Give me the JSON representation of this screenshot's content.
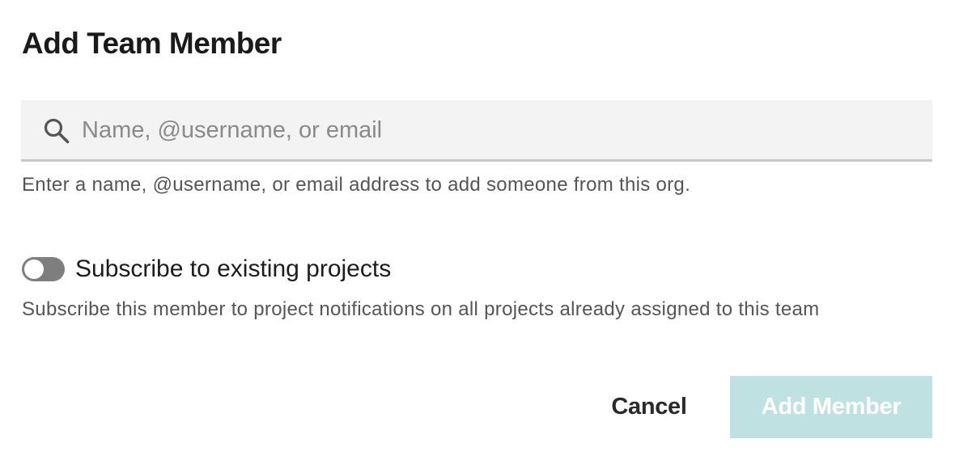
{
  "dialog": {
    "title": "Add Team Member"
  },
  "search": {
    "placeholder": "Name, @username, or email",
    "value": "",
    "icon": "search-icon",
    "help_text": "Enter a name, @username, or email address to add someone from this org."
  },
  "subscribe": {
    "label": "Subscribe to existing projects",
    "checked": false,
    "help_text": "Subscribe this member to project notifications on all projects already assigned to this team"
  },
  "actions": {
    "cancel_label": "Cancel",
    "add_label": "Add Member",
    "add_disabled": true
  },
  "colors": {
    "accent_disabled": "#bfe1e1",
    "toggle_off": "#7e7e7e",
    "input_bg": "#f3f3f3"
  }
}
